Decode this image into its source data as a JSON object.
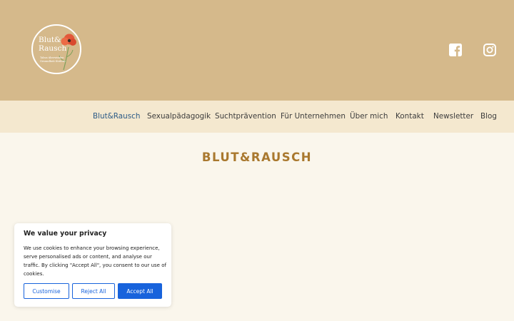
{
  "logo": {
    "line1": "Blut&",
    "line2": "Rausch",
    "tagline": "Tabus überwinden Gesundheit fördern"
  },
  "social": [
    {
      "icon": "facebook-icon"
    },
    {
      "icon": "instagram-icon"
    }
  ],
  "nav": {
    "items": [
      {
        "label": "Blut&Rausch",
        "active": true
      },
      {
        "label": "Sexualpädagogik"
      },
      {
        "label": "Suchtprävention"
      },
      {
        "label": "Für Unternehmen"
      },
      {
        "label": "Über mich"
      },
      {
        "label": "Kontakt"
      },
      {
        "label": "Newsletter"
      },
      {
        "label": "Blog"
      }
    ]
  },
  "page": {
    "title": "BLUT&RAUSCH"
  },
  "cookie": {
    "title": "We value your privacy",
    "text": "We use cookies to enhance your browsing experience, serve personalised ads or content, and analyse our traffic. By clicking \"Accept All\", you consent to our use of cookies.",
    "customise_label": "Customise",
    "reject_label": "Reject All",
    "accept_label": "Accept All"
  },
  "colors": {
    "header": "#d5b98b",
    "nav_bg": "#f4e8cf",
    "page_bg": "#faf6ec",
    "title": "#a9782e",
    "nav_active": "#2b5a86",
    "button_blue": "#1863dc"
  }
}
